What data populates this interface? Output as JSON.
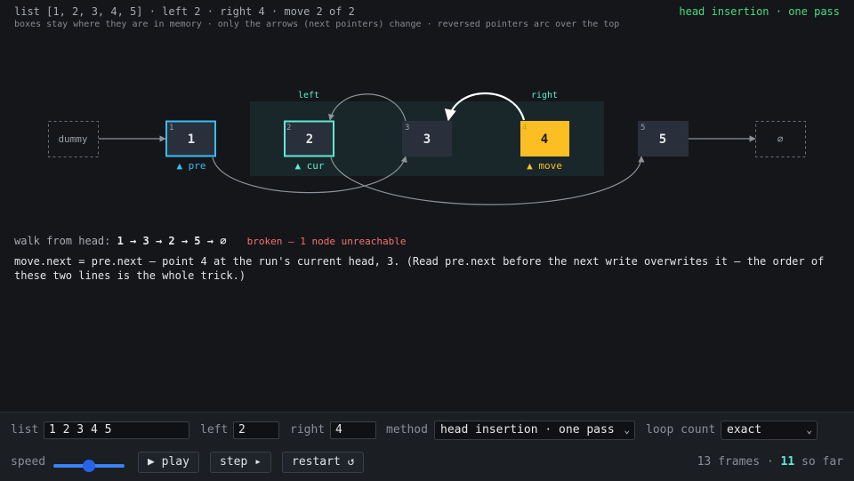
{
  "header": {
    "info": "list [1, 2, 3, 4, 5] · left 2 · right 4 · move 2 of 2",
    "subtitle": "boxes stay where they are in memory · only the arrows (next pointers) change · reversed pointers arc over the top",
    "method_badge": "head insertion · one pass"
  },
  "diagram": {
    "dummy_label": "dummy",
    "null_label": "⌀",
    "region_left_label": "left",
    "region_right_label": "right",
    "nodes": [
      {
        "index": "1",
        "value": "1"
      },
      {
        "index": "2",
        "value": "2"
      },
      {
        "index": "3",
        "value": "3"
      },
      {
        "index": "4",
        "value": "4"
      },
      {
        "index": "5",
        "value": "5"
      }
    ],
    "markers": {
      "pre": "▲ pre",
      "cur": "▲ cur",
      "move": "▲ move"
    },
    "colors": {
      "pre": "#38bdf8",
      "cur": "#5eead4",
      "move": "#fbbf24",
      "node_fill": "#2a303b",
      "region": "#19272a"
    }
  },
  "walk": {
    "label": "walk from head:",
    "sequence": "1 → 3 → 2 → 5 → ⌀",
    "status": "broken — 1 node unreachable"
  },
  "explanation": "move.next = pre.next — point 4 at the run's current head, 3. (Read pre.next before the next write overwrites it — the order of these two lines is the whole trick.)",
  "controls": {
    "list_label": "list",
    "list_value": "1 2 3 4 5",
    "left_label": "left",
    "left_value": "2",
    "right_label": "right",
    "right_value": "4",
    "method_label": "method",
    "method_value": "head insertion · one pass",
    "loop_label": "loop count",
    "loop_value": "exact",
    "speed_label": "speed",
    "speed_level": 0.5,
    "play_label": "▶ play",
    "step_label": "step ▸",
    "restart_label": "restart ↺",
    "frames_total": "13 frames",
    "frames_separator": "·",
    "frames_current": "11",
    "frames_suffix": "so far"
  }
}
